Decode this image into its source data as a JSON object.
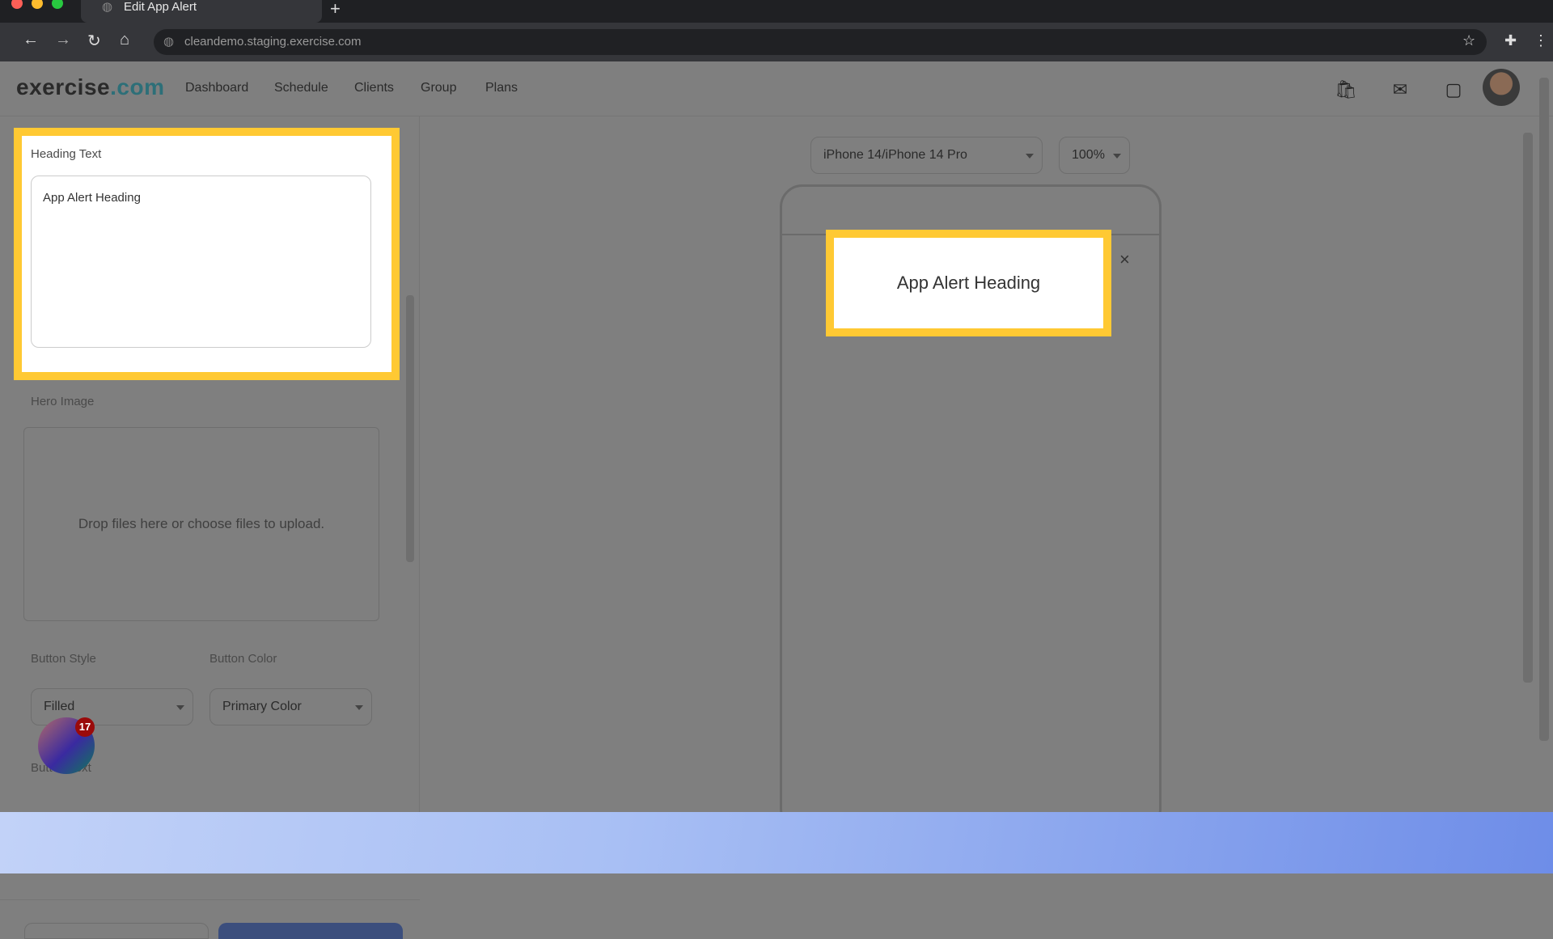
{
  "browser": {
    "tab_title": "Edit App Alert",
    "new_tab": "+",
    "url": "cleandemo.staging.exercise.com"
  },
  "header": {
    "logo_main": "exercise",
    "logo_suffix": ".com",
    "nav": [
      "Dashboard",
      "Schedule",
      "Clients",
      "Group",
      "Plans"
    ]
  },
  "form": {
    "heading_label": "Heading Text",
    "heading_value": "App Alert Heading",
    "hero_label": "Hero Image",
    "drop_text": "Drop files here or choose files to upload.",
    "button_style_label": "Button Style",
    "button_style_value": "Filled",
    "button_color_label": "Button Color",
    "button_color_value": "Primary Color",
    "button_text_label": "Button Text"
  },
  "preview": {
    "device": "iPhone 14/iPhone 14 Pro",
    "zoom": "100%",
    "alert_heading": "App Alert Heading",
    "close": "×"
  },
  "widget": {
    "badge": "17"
  },
  "colors": {
    "highlight": "#ffc933",
    "brand": "#2d6f78"
  }
}
